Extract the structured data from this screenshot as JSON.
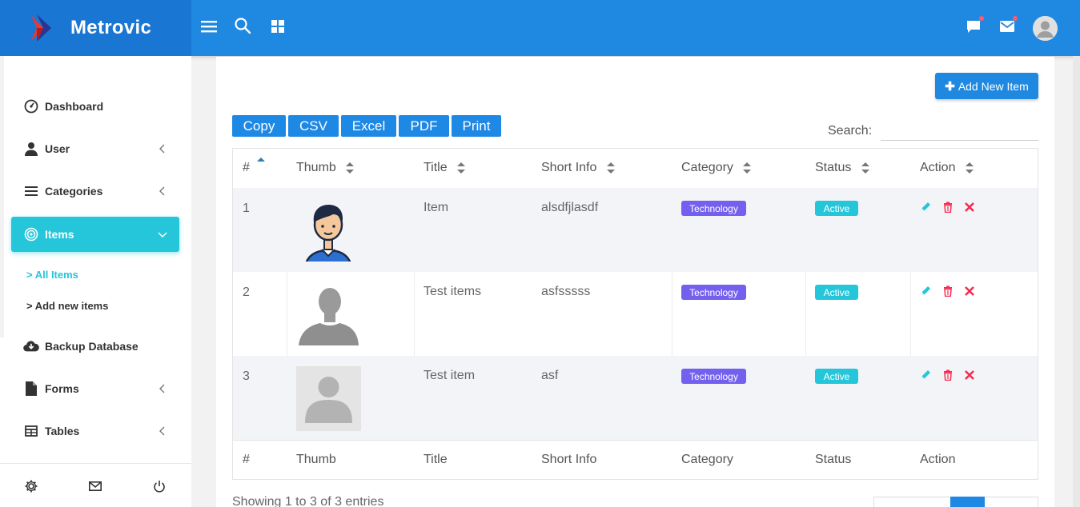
{
  "app": {
    "name": "Metrovic"
  },
  "topbar": {
    "icons": [
      "menu-icon",
      "search-icon",
      "grid-icon",
      "chat-icon",
      "mail-icon",
      "avatar"
    ]
  },
  "sidebar": {
    "items": [
      {
        "label": "Dashboard",
        "icon": "dashboard-icon"
      },
      {
        "label": "User",
        "icon": "user-icon"
      },
      {
        "label": "Categories",
        "icon": "list-icon"
      },
      {
        "label": "Items",
        "icon": "target-icon"
      },
      {
        "label": "Backup Database",
        "icon": "cloud-download-icon"
      },
      {
        "label": "Forms",
        "icon": "file-icon"
      },
      {
        "label": "Tables",
        "icon": "table-icon"
      }
    ],
    "subitems": [
      {
        "label": "> All Items"
      },
      {
        "label": "> Add new items"
      }
    ],
    "footer_icons": [
      "settings-icon",
      "mail-icon",
      "power-icon"
    ]
  },
  "toolbar": {
    "add_label": "Add New Item",
    "export_buttons": [
      "Copy",
      "CSV",
      "Excel",
      "PDF",
      "Print"
    ],
    "search_label": "Search:",
    "search_value": ""
  },
  "table": {
    "columns": [
      "#",
      "Thumb",
      "Title",
      "Short Info",
      "Category",
      "Status",
      "Action"
    ],
    "rows": [
      {
        "num": "1",
        "thumb": "cartoon-avatar",
        "title": "Item",
        "info": "alsdfjlasdf",
        "category": "Technology",
        "status": "Active"
      },
      {
        "num": "2",
        "thumb": "silhouette-photo",
        "title": "Test items",
        "info": "asfsssss",
        "category": "Technology",
        "status": "Active"
      },
      {
        "num": "3",
        "thumb": "placeholder-avatar",
        "title": "Test item",
        "info": "asf",
        "category": "Technology",
        "status": "Active"
      }
    ],
    "info": "Showing 1 to 3 of 3 entries"
  },
  "colors": {
    "primary": "#1f88e0",
    "cyan": "#26c6da",
    "purple": "#7460ee",
    "edit": "#26c6da",
    "delete": "#f62d51"
  }
}
